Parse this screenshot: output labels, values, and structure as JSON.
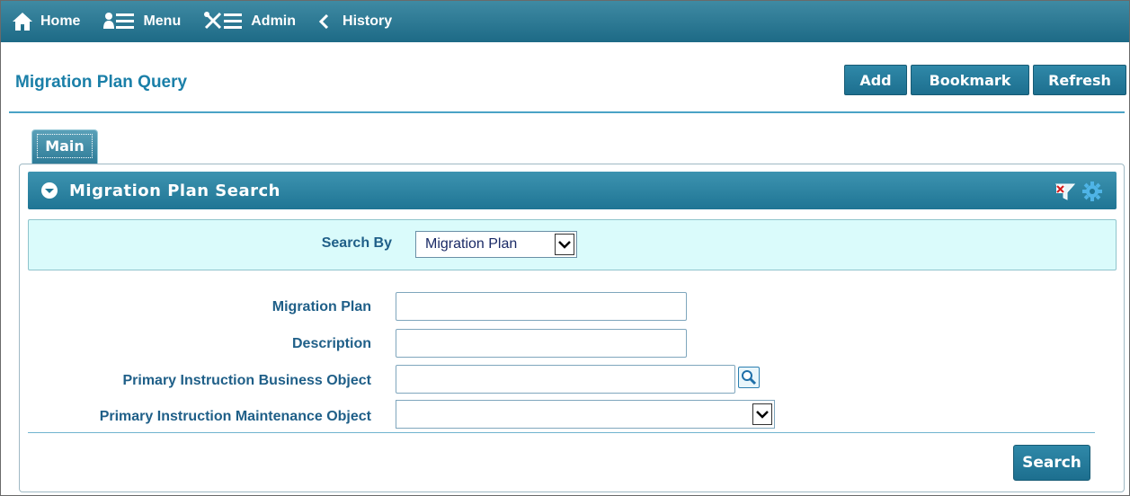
{
  "nav": {
    "home": "Home",
    "menu": "Menu",
    "admin": "Admin",
    "history": "History"
  },
  "header": {
    "title": "Migration Plan Query",
    "buttons": {
      "add": "Add",
      "bookmark": "Bookmark",
      "refresh": "Refresh"
    }
  },
  "tabs": [
    {
      "label": "Main",
      "active": true
    }
  ],
  "section": {
    "title": "Migration Plan Search",
    "search_by": {
      "label": "Search By",
      "selected": "Migration Plan"
    },
    "fields": {
      "migration_plan": {
        "label": "Migration Plan",
        "value": ""
      },
      "description": {
        "label": "Description",
        "value": ""
      },
      "primary_bo": {
        "label": "Primary Instruction Business Object",
        "value": ""
      },
      "primary_mo": {
        "label": "Primary Instruction Maintenance Object",
        "selected": ""
      }
    },
    "search_button": "Search"
  },
  "colors": {
    "nav_bar": "#1d6a86",
    "accent": "#1a7fa8",
    "label": "#1f5f88",
    "search_by_bg": "#dafbfb"
  },
  "icons": {
    "home": "home-icon",
    "menu": "menu-icon",
    "admin": "admin-tools-icon",
    "history": "chevron-left-icon",
    "collapse": "collapse-circle-icon",
    "clear_filter": "clear-filter-icon",
    "settings": "gear-icon",
    "lookup": "magnifier-icon"
  }
}
